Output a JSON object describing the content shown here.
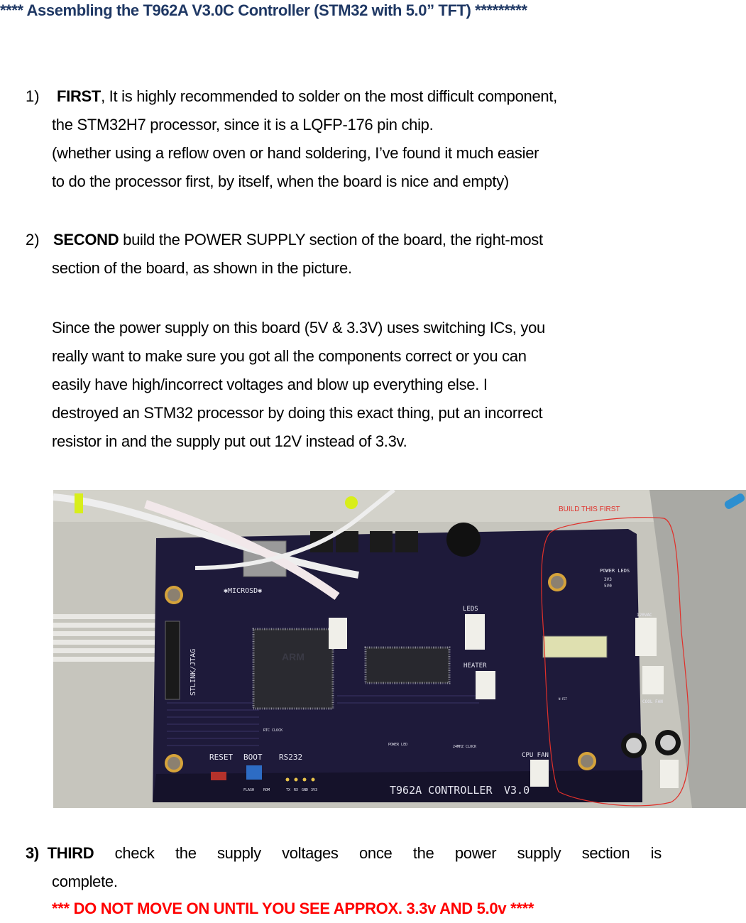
{
  "document": {
    "title": "**** Assembling the T962A V3.0C Controller (STM32 with 5.0” TFT) *********",
    "steps": [
      {
        "number": "1)",
        "keyword": "FIRST",
        "lines": [
          ", It is highly recommended to solder on the most difficult component,",
          "the STM32H7 processor, since it is a LQFP-176 pin chip.",
          "(whether using a reflow oven or hand soldering, I’ve found it much easier",
          "to do the processor first, by itself, when the board is nice and empty)"
        ]
      },
      {
        "number": "2)",
        "keyword": "SECOND",
        "lines": [
          " build the POWER SUPPLY section of the board, the right-most",
          "section of the board, as shown in the picture."
        ],
        "note_lines": [
          "Since the power supply on this board (5V & 3.3V) uses switching ICs, you",
          "really want to make sure you got all the components correct or you can",
          "easily have high/incorrect voltages and blow up everything else.  I",
          "destroyed an STM32 processor by doing this exact thing, put an incorrect",
          "resistor in and the supply put out 12V instead of 3.3v."
        ]
      },
      {
        "number": "3)",
        "keyword": "THIRD",
        "line1_words": [
          "check",
          "the",
          "supply",
          "voltages",
          "once",
          "the",
          "power",
          "supply",
          "section",
          "is"
        ],
        "line2": "complete.",
        "warning": "*** DO NOT MOVE ON UNTIL YOU SEE  APPROX. 3.3v AND 5.0v ****"
      }
    ]
  },
  "photo": {
    "description": "T962A controller PCB photo",
    "annotation": "BUILD THIS FIRST",
    "silkscreen": {
      "microsd": "✱MICROSD✱",
      "stlink": "STLINK/JTAG",
      "reset": "RESET",
      "boot": "BOOT",
      "rs232": "RS232",
      "flash": "FLASH",
      "rom": "ROM",
      "tx": "TX",
      "rx": "RX",
      "gnd": "GND",
      "v33": "3V3",
      "rtc_clock": "RTC CLOCK",
      "power_led": "POWER LED",
      "clock_24mhz": "24MHZ CLOCK",
      "board_name": "T962A  CONTROLLER",
      "version": "V3.0",
      "leds": "LEDS",
      "heater": "HEATER",
      "cpu_fan": "CPU FAN",
      "power_leds": "POWER LEDS",
      "led_3v3": "3V3",
      "led_5v0": "5V0",
      "vac_120": "120VAC",
      "cool_fan": "COOL FAN",
      "nfet": "N-FET",
      "chip_logo": "ARM"
    },
    "colors": {
      "pcb": "#1e1a3a",
      "annotation": "#e0302a",
      "zip_tie": "#d8ee1a"
    }
  }
}
